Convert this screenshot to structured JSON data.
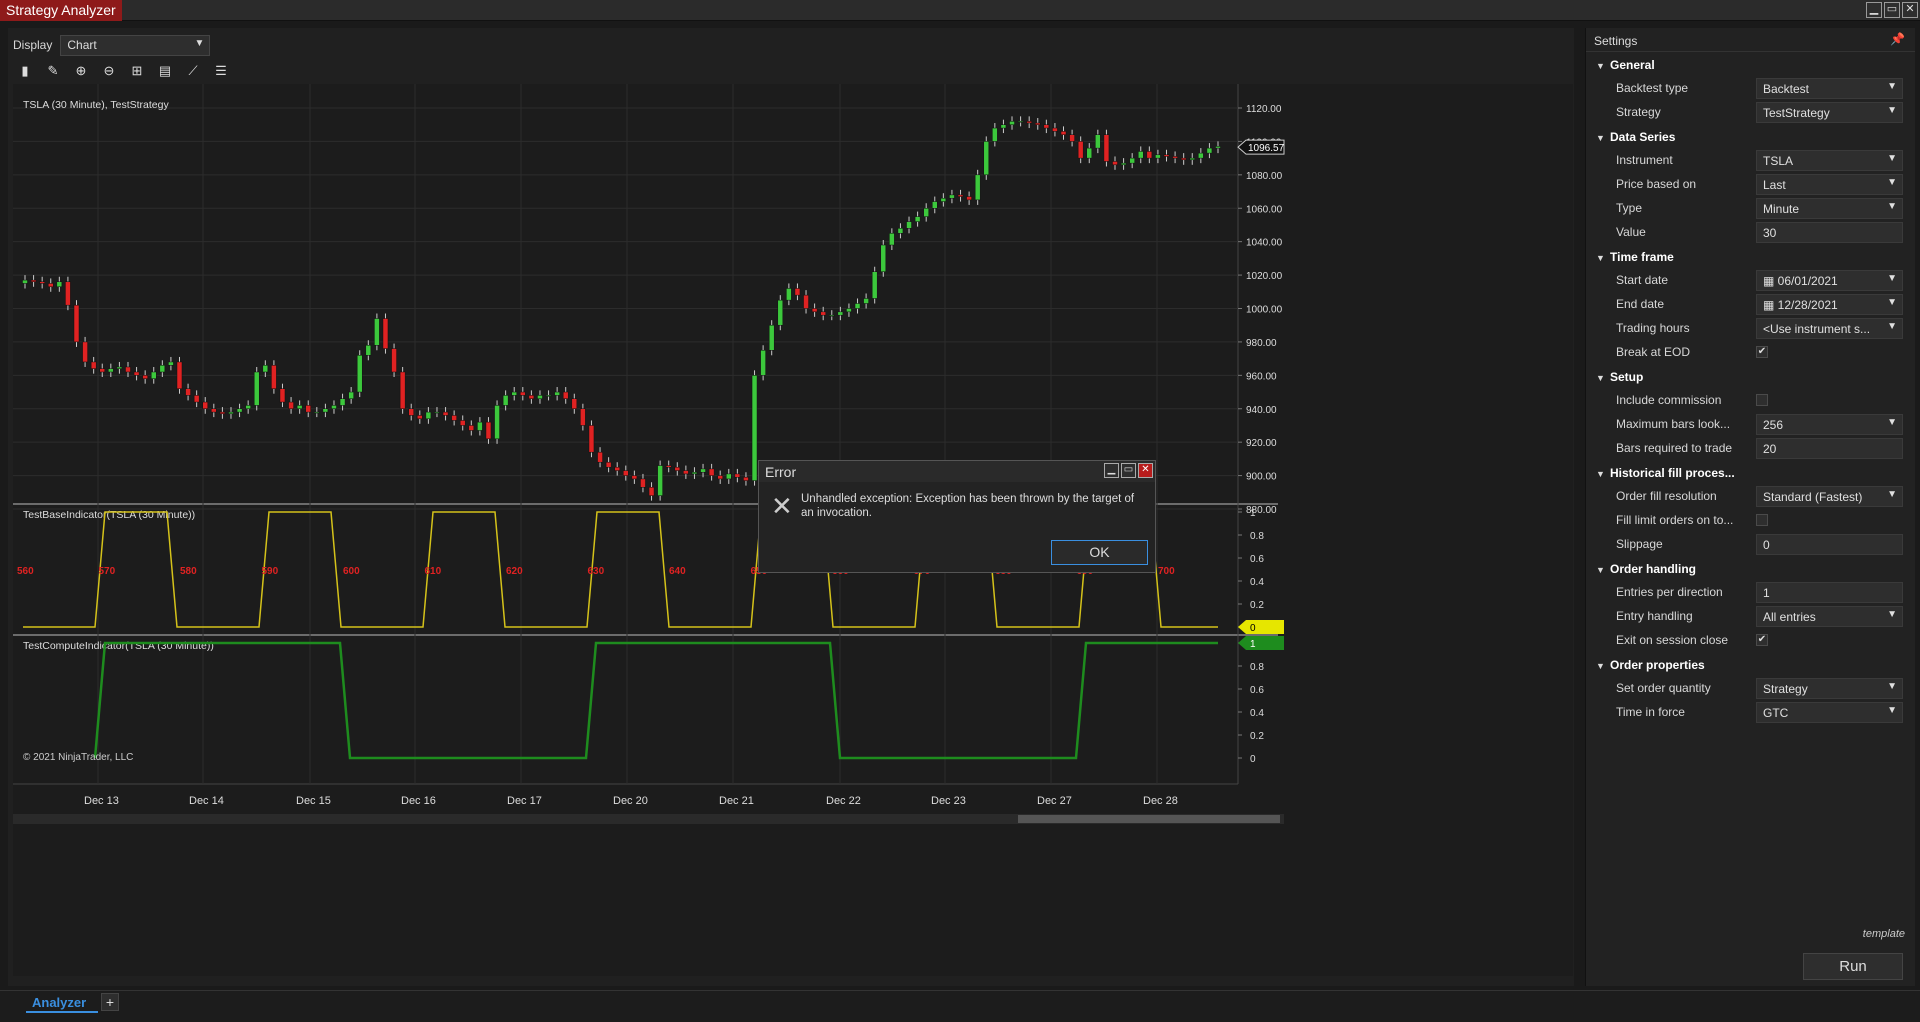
{
  "window": {
    "title": "Strategy Analyzer",
    "buttons": [
      "▁",
      "▭",
      "✕"
    ]
  },
  "display": {
    "label": "Display",
    "value": "Chart"
  },
  "toolbar": {
    "icons": [
      "bars-icon",
      "pencil-icon",
      "zoom-in-icon",
      "zoom-out-icon",
      "crosshair-icon",
      "properties-icon",
      "strategies-icon",
      "data-box-icon"
    ]
  },
  "chart": {
    "title": "TSLA (30 Minute), TestStrategy",
    "price_label": "1096.57",
    "copyright": "© 2021 NinjaTrader, LLC",
    "price_ticks": [
      "1120.00",
      "1100.00",
      "1080.00",
      "1060.00",
      "1040.00",
      "1020.00",
      "1000.00",
      "980.00",
      "960.00",
      "940.00",
      "920.00",
      "900.00",
      "880.00"
    ],
    "date_labels": [
      "Dec 13",
      "Dec 14",
      "Dec 15",
      "Dec 16",
      "Dec 17",
      "Dec 20",
      "Dec 21",
      "Dec 22",
      "Dec 23",
      "Dec 27",
      "Dec 28"
    ],
    "panel2_title": "TestBaseIndicator(TSLA (30 Minute))",
    "panel2_ticks": [
      "1",
      "0.8",
      "0.6",
      "0.4",
      "0.2",
      "0"
    ],
    "panel2_value": "0",
    "bar_numbers": [
      "560",
      "570",
      "580",
      "590",
      "600",
      "610",
      "620",
      "630",
      "640",
      "650",
      "660",
      "670",
      "680",
      "690",
      "700"
    ],
    "panel3_title": "TestComputeIndicator(TSLA (30 Minute))",
    "panel3_ticks": [
      "1",
      "0.8",
      "0.6",
      "0.4",
      "0.2",
      "0"
    ],
    "panel3_value": "1",
    "colors": {
      "up": "#3cc83c",
      "down": "#e02222",
      "panel2_line": "#d4c21a",
      "panel3_line": "#1e8c1e",
      "bar_number": "#e02222"
    }
  },
  "settings": {
    "title": "Settings",
    "categories": [
      {
        "name": "General",
        "rows": [
          {
            "label": "Backtest type",
            "value": "Backtest",
            "kind": "select"
          },
          {
            "label": "Strategy",
            "value": "TestStrategy",
            "kind": "select"
          }
        ]
      },
      {
        "name": "Data Series",
        "rows": [
          {
            "label": "Instrument",
            "value": "TSLA",
            "kind": "select"
          },
          {
            "label": "Price based on",
            "value": "Last",
            "kind": "select"
          },
          {
            "label": "Type",
            "value": "Minute",
            "kind": "select"
          },
          {
            "label": "Value",
            "value": "30",
            "kind": "text"
          }
        ]
      },
      {
        "name": "Time frame",
        "rows": [
          {
            "label": "Start date",
            "value": "06/01/2021",
            "kind": "date"
          },
          {
            "label": "End date",
            "value": "12/28/2021",
            "kind": "date"
          },
          {
            "label": "Trading hours",
            "value": "<Use instrument s...",
            "kind": "select"
          },
          {
            "label": "Break at EOD",
            "value": "",
            "kind": "check",
            "checked": true
          }
        ]
      },
      {
        "name": "Setup",
        "rows": [
          {
            "label": "Include commission",
            "value": "",
            "kind": "check",
            "checked": false
          },
          {
            "label": "Maximum bars look...",
            "value": "256",
            "kind": "select"
          },
          {
            "label": "Bars required to trade",
            "value": "20",
            "kind": "text"
          }
        ]
      },
      {
        "name": "Historical fill proces...",
        "rows": [
          {
            "label": "Order fill resolution",
            "value": "Standard (Fastest)",
            "kind": "select"
          },
          {
            "label": "Fill limit orders on to...",
            "value": "",
            "kind": "check",
            "checked": false
          },
          {
            "label": "Slippage",
            "value": "0",
            "kind": "text"
          }
        ]
      },
      {
        "name": "Order handling",
        "rows": [
          {
            "label": "Entries per direction",
            "value": "1",
            "kind": "text"
          },
          {
            "label": "Entry handling",
            "value": "All entries",
            "kind": "select"
          },
          {
            "label": "Exit on session close",
            "value": "",
            "kind": "check",
            "checked": true
          }
        ]
      },
      {
        "name": "Order properties",
        "rows": [
          {
            "label": "Set order quantity",
            "value": "Strategy",
            "kind": "select"
          },
          {
            "label": "Time in force",
            "value": "GTC",
            "kind": "select"
          }
        ]
      }
    ],
    "template_link": "template",
    "run_label": "Run"
  },
  "tabs": {
    "active": "Analyzer",
    "add": "+"
  },
  "dialog": {
    "title": "Error",
    "message": "Unhandled exception: Exception has been thrown by the target of an invocation.",
    "ok_label": "OK"
  }
}
